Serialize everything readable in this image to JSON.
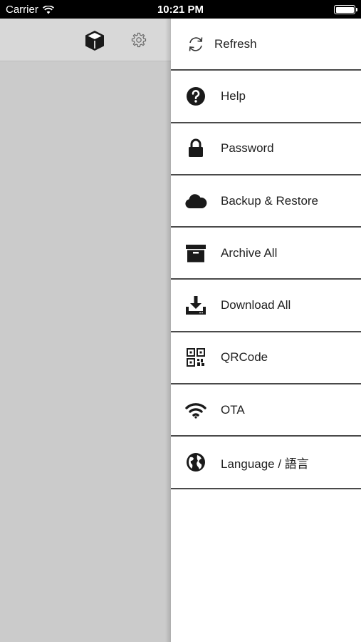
{
  "status_bar": {
    "carrier": "Carrier",
    "time": "10:21 PM"
  },
  "left_header": {
    "icons": [
      "cube-icon",
      "gear-icon"
    ]
  },
  "menu": {
    "items": [
      {
        "label": "Refresh",
        "icon": "refresh-icon"
      },
      {
        "label": "Help",
        "icon": "help-icon"
      },
      {
        "label": "Password",
        "icon": "lock-icon"
      },
      {
        "label": "Backup & Restore",
        "icon": "cloud-icon"
      },
      {
        "label": "Archive All",
        "icon": "archive-icon"
      },
      {
        "label": "Download All",
        "icon": "download-icon"
      },
      {
        "label": "QRCode",
        "icon": "qrcode-icon"
      },
      {
        "label": "OTA",
        "icon": "wifi-icon"
      },
      {
        "label": "Language / 語言",
        "icon": "globe-icon"
      }
    ]
  },
  "colors": {
    "left_pane": "#cbcbcb",
    "divider": "#4a4a4a",
    "icon": "#1a1a1a"
  }
}
